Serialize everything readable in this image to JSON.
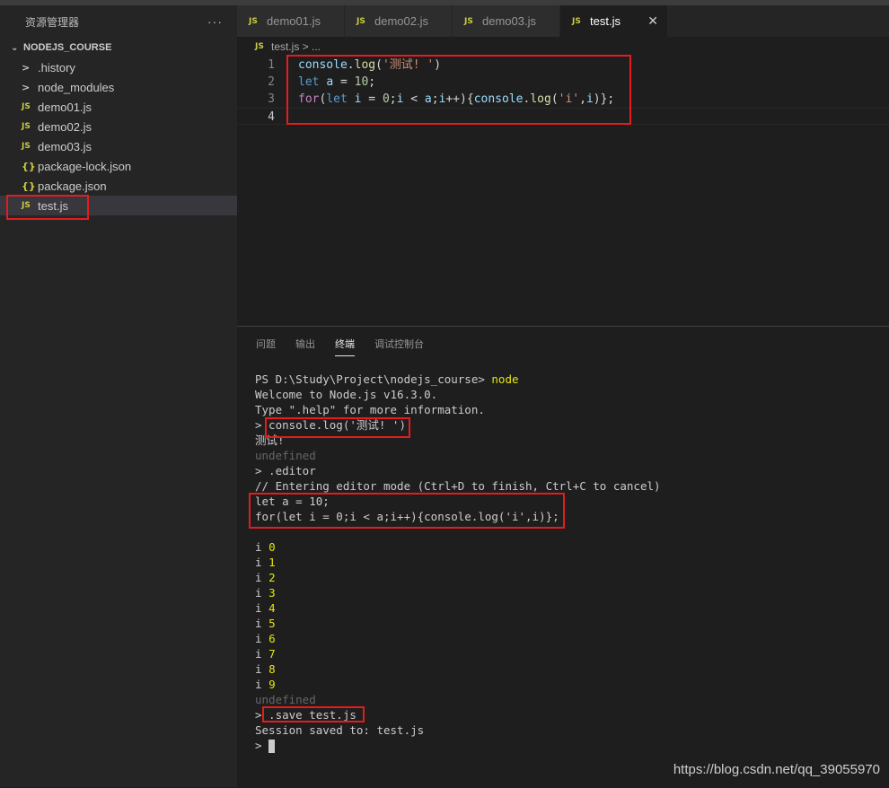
{
  "sidebar": {
    "title": "资源管理器",
    "more": "···",
    "folder": "NODEJS_COURSE",
    "items": [
      {
        "label": ".history",
        "icon": ">"
      },
      {
        "label": "node_modules",
        "icon": ">"
      },
      {
        "label": "demo01.js",
        "icon": "JS"
      },
      {
        "label": "demo02.js",
        "icon": "JS"
      },
      {
        "label": "demo03.js",
        "icon": "JS"
      },
      {
        "label": "package-lock.json",
        "icon": "{}"
      },
      {
        "label": "package.json",
        "icon": "{}"
      },
      {
        "label": "test.js",
        "icon": "JS"
      }
    ]
  },
  "tabs": [
    {
      "label": "demo01.js",
      "icon": "JS"
    },
    {
      "label": "demo02.js",
      "icon": "JS"
    },
    {
      "label": "demo03.js",
      "icon": "JS"
    },
    {
      "label": "test.js",
      "icon": "JS"
    }
  ],
  "tab_close": "✕",
  "breadcrumb": {
    "icon": "JS",
    "text": "test.js > ..."
  },
  "editor": {
    "line_numbers": [
      "1",
      "2",
      "3",
      "4"
    ],
    "line1": {
      "a": "console",
      "b": ".",
      "c": "log",
      "d": "(",
      "e": "'测试! '",
      "f": ")"
    },
    "line2": {
      "a": "let",
      "b": " ",
      "c": "a",
      "d": " = ",
      "e": "10",
      "f": ";"
    },
    "line3": {
      "a": "for",
      "b": "(",
      "c": "let",
      "d": " ",
      "e": "i",
      "f": " = ",
      "g": "0",
      "h": ";",
      "i": "i",
      "j": " < ",
      "k": "a",
      "l": ";",
      "m": "i",
      "n": "++){",
      "o": "console",
      "p": ".",
      "q": "log",
      "r": "(",
      "s": "'i'",
      "t": ",",
      "u": "i",
      "v": ")};"
    }
  },
  "panel_tabs": [
    "问题",
    "输出",
    "终端",
    "调试控制台"
  ],
  "terminal": {
    "prompt_line": {
      "prefix": "PS D:\\Study\\Project\\nodejs_course> ",
      "cmd": "node"
    },
    "welcome": "Welcome to Node.js v16.3.0.",
    "help": "Type \".help\" for more information.",
    "log_cmd": "> console.log('测试! ')",
    "log_out": "测试!",
    "undefined1": "undefined",
    "editor_cmd": "> .editor",
    "editor_msg": "// Entering editor mode (Ctrl+D to finish, Ctrl+C to cancel)",
    "code1": "let a = 10;",
    "code2": "for(let i = 0;i < a;i++){console.log('i',i)};",
    "outputs": [
      {
        "label": "i ",
        "value": "0"
      },
      {
        "label": "i ",
        "value": "1"
      },
      {
        "label": "i ",
        "value": "2"
      },
      {
        "label": "i ",
        "value": "3"
      },
      {
        "label": "i ",
        "value": "4"
      },
      {
        "label": "i ",
        "value": "5"
      },
      {
        "label": "i ",
        "value": "6"
      },
      {
        "label": "i ",
        "value": "7"
      },
      {
        "label": "i ",
        "value": "8"
      },
      {
        "label": "i ",
        "value": "9"
      }
    ],
    "undefined2": "undefined",
    "save_cmd": "> .save test.js",
    "save_msg": "Session saved to: test.js",
    "last_prompt": "> "
  },
  "watermark": "https://blog.csdn.net/qq_39055970",
  "colors": {
    "highlight_box": "#e41c1c",
    "js_icon": "#cbcb41"
  }
}
